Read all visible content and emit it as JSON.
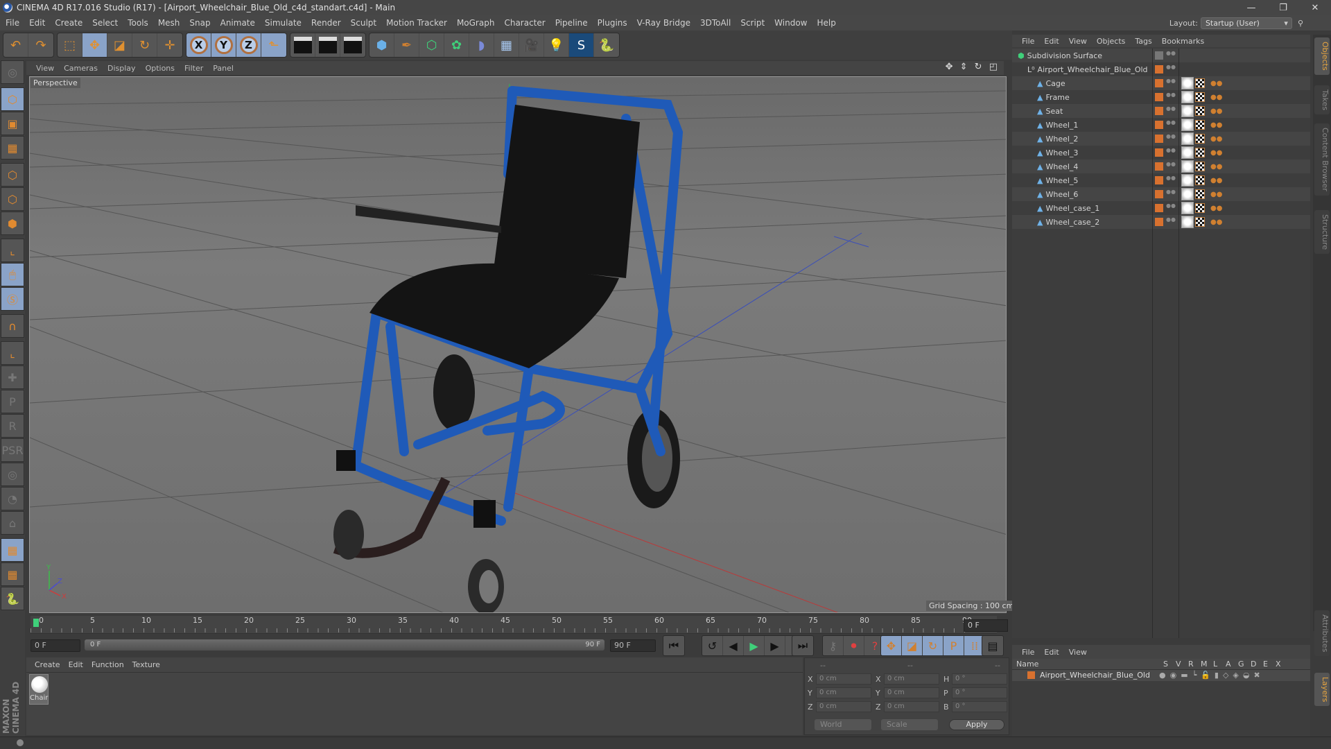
{
  "window": {
    "title": "CINEMA 4D R17.016 Studio (R17) - [Airport_Wheelchair_Blue_Old_c4d_standart.c4d] - Main",
    "controls": [
      "minimize-icon",
      "restore-icon",
      "close-icon"
    ],
    "control_glyphs": [
      "—",
      "❐",
      "✕"
    ]
  },
  "menubar": [
    "File",
    "Edit",
    "Create",
    "Select",
    "Tools",
    "Mesh",
    "Snap",
    "Animate",
    "Simulate",
    "Render",
    "Sculpt",
    "Motion Tracker",
    "MoGraph",
    "Character",
    "Pipeline",
    "Plugins",
    "V-Ray Bridge",
    "3DToAll",
    "Script",
    "Window",
    "Help"
  ],
  "layout": {
    "label": "Layout:",
    "value": "Startup (User)"
  },
  "toolbar": {
    "groups": [
      [
        {
          "name": "undo",
          "glyph": "↶"
        },
        {
          "name": "redo",
          "glyph": "↷"
        }
      ],
      [
        {
          "name": "live-selection",
          "glyph": "⬚"
        },
        {
          "name": "move",
          "glyph": "✥",
          "active": true
        },
        {
          "name": "scale",
          "glyph": "◪"
        },
        {
          "name": "rotate",
          "glyph": "↻"
        },
        {
          "name": "transform",
          "glyph": "✛"
        }
      ],
      [
        {
          "name": "x-axis",
          "glyph": "X"
        },
        {
          "name": "y-axis",
          "glyph": "Y"
        },
        {
          "name": "z-axis",
          "glyph": "Z"
        },
        {
          "name": "coordinate-system",
          "glyph": "⬑"
        }
      ],
      [
        {
          "name": "render-view",
          "glyph": "▶"
        },
        {
          "name": "render-picture-viewer",
          "glyph": "▶"
        },
        {
          "name": "render-settings",
          "glyph": "▶"
        }
      ],
      [
        {
          "name": "cube",
          "glyph": "⬢"
        },
        {
          "name": "pen",
          "glyph": "✒"
        },
        {
          "name": "subdivision",
          "glyph": "⬡"
        },
        {
          "name": "cloner",
          "glyph": "✿"
        },
        {
          "name": "deformer",
          "glyph": "◗"
        },
        {
          "name": "floor",
          "glyph": "▦"
        },
        {
          "name": "camera",
          "glyph": "🎥"
        },
        {
          "name": "light",
          "glyph": "💡"
        },
        {
          "name": "vray",
          "glyph": "S"
        },
        {
          "name": "python",
          "glyph": "🐍"
        }
      ]
    ]
  },
  "left_tools": [
    {
      "name": "make-editable",
      "glyph": "◎",
      "dim": true
    },
    {
      "name": "model-mode",
      "glyph": "⬡",
      "active": true
    },
    {
      "name": "texture-mode",
      "glyph": "▣"
    },
    {
      "name": "workplane-mode",
      "glyph": "▦"
    },
    {
      "name": "points-mode",
      "glyph": "⬡"
    },
    {
      "name": "edges-mode",
      "glyph": "⬡"
    },
    {
      "name": "polygons-mode",
      "glyph": "⬢"
    },
    {
      "name": "axis-mode",
      "glyph": "⌞"
    },
    {
      "name": "tweak-mode",
      "glyph": "🖱",
      "active": true
    },
    {
      "name": "solo-mode",
      "glyph": "Ⓢ",
      "active": true
    },
    {
      "name": "snap",
      "glyph": "∩"
    },
    {
      "name": "workplane",
      "glyph": "⌞"
    },
    {
      "name": "add-key",
      "glyph": "✚",
      "dim": true
    },
    {
      "name": "key-position",
      "glyph": "P",
      "dim": true
    },
    {
      "name": "key-rotation",
      "glyph": "R",
      "dim": true
    },
    {
      "name": "key-psr",
      "glyph": "PSR",
      "dim": true
    },
    {
      "name": "key-point",
      "glyph": "◎",
      "dim": true
    },
    {
      "name": "key-parameter",
      "glyph": "◔",
      "dim": true
    },
    {
      "name": "key-pla",
      "glyph": "⌂",
      "dim": true
    },
    {
      "name": "lock-workplane",
      "glyph": "▦",
      "active": true
    },
    {
      "name": "align-workplane",
      "glyph": "▦"
    },
    {
      "name": "python-script",
      "glyph": "🐍"
    }
  ],
  "viewport": {
    "menu": [
      "View",
      "Cameras",
      "Display",
      "Options",
      "Filter",
      "Panel"
    ],
    "label": "Perspective",
    "grid_spacing": "Grid Spacing : 100 cm",
    "nav_icons": [
      "move-view-icon",
      "zoom-view-icon",
      "rotate-view-icon",
      "maximize-view-icon"
    ],
    "nav_glyphs": [
      "✥",
      "⇕",
      "↻",
      "◰"
    ],
    "axis_labels": [
      "Y",
      "Z",
      "X"
    ]
  },
  "timeline": {
    "ticks": [
      "0",
      "5",
      "10",
      "15",
      "20",
      "25",
      "30",
      "35",
      "40",
      "45",
      "50",
      "55",
      "60",
      "65",
      "70",
      "75",
      "80",
      "85",
      "90"
    ],
    "current_frame": "0 F",
    "start": "0 F",
    "slider_start": "0 F",
    "slider_end": "90 F",
    "end": "90 F"
  },
  "playback": {
    "groups": [
      [
        {
          "name": "go-to-start",
          "glyph": "⏮"
        }
      ],
      [
        {
          "name": "previous-key",
          "glyph": "↺"
        },
        {
          "name": "previous-frame",
          "glyph": "◀"
        },
        {
          "name": "play",
          "glyph": "▶"
        },
        {
          "name": "next-frame",
          "glyph": "▶"
        },
        {
          "name": "next-key",
          "glyph": "↻"
        }
      ],
      [
        {
          "name": "go-to-end",
          "glyph": "⏭"
        }
      ],
      [
        {
          "name": "motion-record",
          "glyph": "⚷"
        },
        {
          "name": "autokey",
          "glyph": "⏺"
        },
        {
          "name": "keyframe-selection",
          "glyph": "?"
        }
      ],
      [
        {
          "name": "key-move",
          "glyph": "✥"
        },
        {
          "name": "key-scale",
          "glyph": "◪"
        },
        {
          "name": "key-rotate",
          "glyph": "↻"
        },
        {
          "name": "key-param",
          "glyph": "P"
        },
        {
          "name": "key-pla",
          "glyph": "⁞⁞"
        }
      ],
      [
        {
          "name": "timeline-window",
          "glyph": "▤"
        }
      ]
    ]
  },
  "material_manager": {
    "menu": [
      "Create",
      "Edit",
      "Function",
      "Texture"
    ],
    "materials": [
      {
        "name": "Chair"
      }
    ]
  },
  "branding": "MAXON CINEMA 4D",
  "coordinates": {
    "header": [
      "--",
      "--",
      "--"
    ],
    "rows": [
      {
        "pos_axis": "X",
        "pos": "0 cm",
        "size_axis": "X",
        "size": "0 cm",
        "rot_axis": "H",
        "rot": "0 °"
      },
      {
        "pos_axis": "Y",
        "pos": "0 cm",
        "size_axis": "Y",
        "size": "0 cm",
        "rot_axis": "P",
        "rot": "0 °"
      },
      {
        "pos_axis": "Z",
        "pos": "0 cm",
        "size_axis": "Z",
        "size": "0 cm",
        "rot_axis": "B",
        "rot": "0 °"
      }
    ],
    "space": "World",
    "mode": "Scale",
    "apply": "Apply"
  },
  "object_manager": {
    "menu": [
      "File",
      "Edit",
      "View",
      "Objects",
      "Tags",
      "Bookmarks"
    ],
    "objects": [
      {
        "name": "Subdivision Surface",
        "indent": 0,
        "type": "subdivision",
        "tags": false
      },
      {
        "name": "Airport_Wheelchair_Blue_Old",
        "indent": 1,
        "type": "null",
        "tags": false
      },
      {
        "name": "Cage",
        "indent": 2,
        "type": "polygon",
        "tags": true
      },
      {
        "name": "Frame",
        "indent": 2,
        "type": "polygon",
        "tags": true
      },
      {
        "name": "Seat",
        "indent": 2,
        "type": "polygon",
        "tags": true
      },
      {
        "name": "Wheel_1",
        "indent": 2,
        "type": "polygon",
        "tags": true
      },
      {
        "name": "Wheel_2",
        "indent": 2,
        "type": "polygon",
        "tags": true
      },
      {
        "name": "Wheel_3",
        "indent": 2,
        "type": "polygon",
        "tags": true
      },
      {
        "name": "Wheel_4",
        "indent": 2,
        "type": "polygon",
        "tags": true
      },
      {
        "name": "Wheel_5",
        "indent": 2,
        "type": "polygon",
        "tags": true
      },
      {
        "name": "Wheel_6",
        "indent": 2,
        "type": "polygon",
        "tags": true
      },
      {
        "name": "Wheel_case_1",
        "indent": 2,
        "type": "polygon",
        "tags": true
      },
      {
        "name": "Wheel_case_2",
        "indent": 2,
        "type": "polygon",
        "tags": true
      }
    ],
    "tag_color": "#d8712f"
  },
  "side_tabs_top": [
    {
      "label": "Objects",
      "active": true
    },
    {
      "label": "Takes",
      "active": false
    },
    {
      "label": "Content Browser",
      "active": false
    },
    {
      "label": "Structure",
      "active": false
    }
  ],
  "side_tabs_bottom": [
    {
      "label": "Attributes",
      "active": false
    },
    {
      "label": "Layers",
      "active": true
    }
  ],
  "layer_manager": {
    "menu": [
      "File",
      "Edit",
      "View"
    ],
    "columns": [
      "Name",
      "S",
      "V",
      "R",
      "M",
      "L",
      "A",
      "G",
      "D",
      "E",
      "X"
    ],
    "layers": [
      {
        "name": "Airport_Wheelchair_Blue_Old",
        "color": "#d8712f"
      }
    ]
  }
}
